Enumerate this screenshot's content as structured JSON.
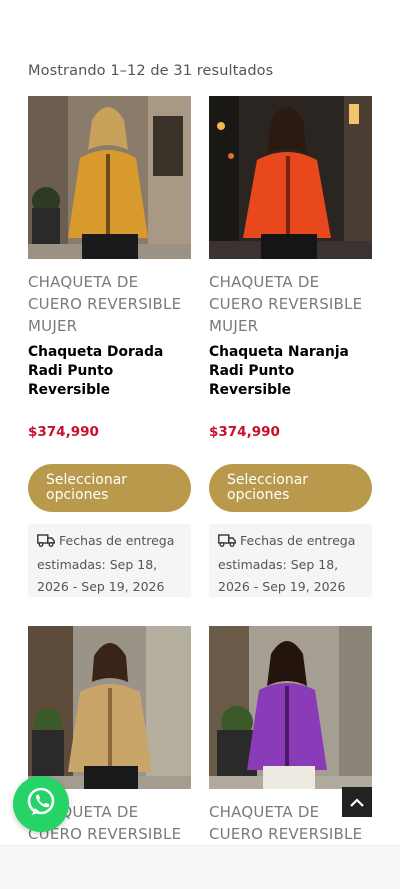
{
  "results_text": "Mostrando 1–12 de 31 resultados",
  "products": [
    {
      "category": "CHAQUETA DE CUERO REVERSIBLE MUJER",
      "title": "Chaqueta Dorada Radi Punto Reversible",
      "price": "$374,990",
      "button": "Seleccionar opciones",
      "delivery": "Fechas de entrega estimadas: Sep 18, 2026 - Sep 19, 2026",
      "jacket_color": "#d89a2c"
    },
    {
      "category": "CHAQUETA DE CUERO REVERSIBLE MUJER",
      "title": "Chaqueta Naranja Radi Punto Reversible",
      "price": "$374,990",
      "button": "Seleccionar opciones",
      "delivery": "Fechas de entrega estimadas: Sep 18, 2026 - Sep 19, 2026",
      "jacket_color": "#e8481c"
    },
    {
      "category": "CHAQUETA DE CUERO REVERSIBLE",
      "jacket_color": "#c9a56a"
    },
    {
      "category": "CHAQUETA DE CUERO REVERSIBLE",
      "jacket_color": "#8a3bb8"
    }
  ],
  "colors": {
    "accent": "#b99a4c",
    "price": "#c8102e",
    "whatsapp": "#25d366"
  },
  "icons": {
    "truck": "truck-icon",
    "whatsapp": "whatsapp-icon",
    "to_top": "chevron-up-icon"
  }
}
